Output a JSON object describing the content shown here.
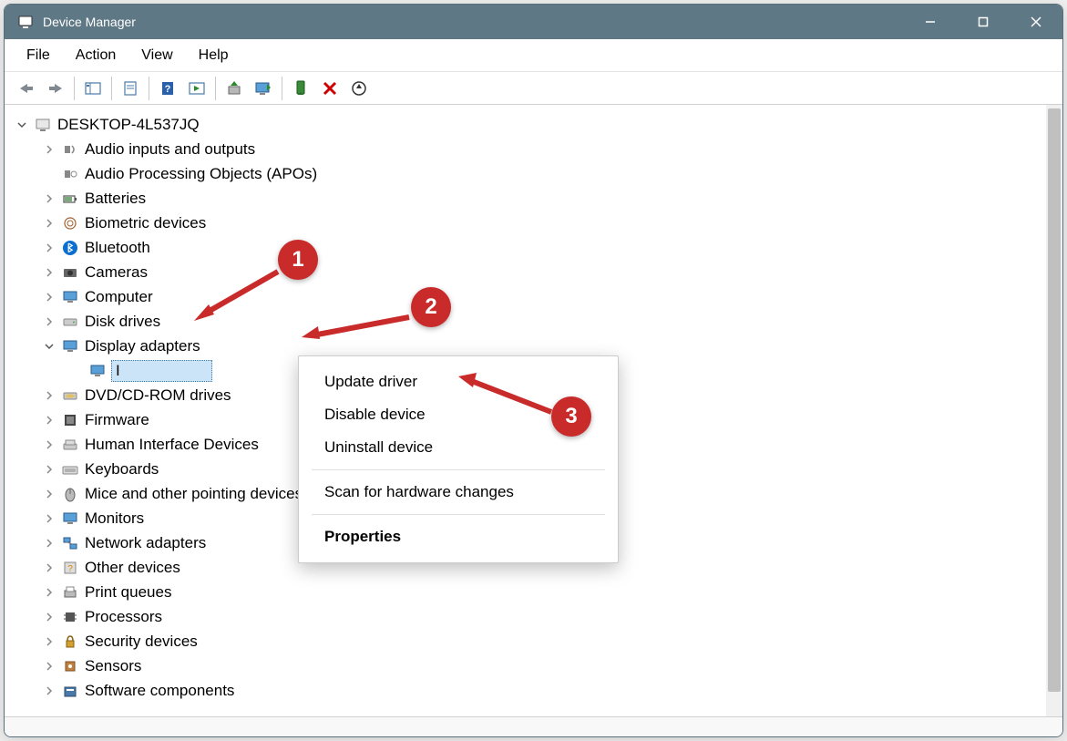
{
  "window": {
    "title": "Device Manager"
  },
  "menus": {
    "file": "File",
    "action": "Action",
    "view": "View",
    "help": "Help"
  },
  "root": {
    "name": "DESKTOP-4L537JQ"
  },
  "categories": [
    {
      "label": "Audio inputs and outputs",
      "expanded": false
    },
    {
      "label": "Audio Processing Objects (APOs)",
      "expanded": false,
      "no_chev": true
    },
    {
      "label": "Batteries",
      "expanded": false
    },
    {
      "label": "Biometric devices",
      "expanded": false
    },
    {
      "label": "Bluetooth",
      "expanded": false
    },
    {
      "label": "Cameras",
      "expanded": false
    },
    {
      "label": "Computer",
      "expanded": false
    },
    {
      "label": "Disk drives",
      "expanded": false
    },
    {
      "label": "Display adapters",
      "expanded": true,
      "child_selected": true
    },
    {
      "label": "DVD/CD-ROM drives",
      "expanded": false
    },
    {
      "label": "Firmware",
      "expanded": false
    },
    {
      "label": "Human Interface Devices",
      "expanded": false
    },
    {
      "label": "Keyboards",
      "expanded": false
    },
    {
      "label": "Mice and other pointing devices",
      "expanded": false
    },
    {
      "label": "Monitors",
      "expanded": false
    },
    {
      "label": "Network adapters",
      "expanded": false
    },
    {
      "label": "Other devices",
      "expanded": false
    },
    {
      "label": "Print queues",
      "expanded": false
    },
    {
      "label": "Processors",
      "expanded": false
    },
    {
      "label": "Security devices",
      "expanded": false
    },
    {
      "label": "Sensors",
      "expanded": false
    },
    {
      "label": "Software components",
      "expanded": false
    }
  ],
  "selected_device": {
    "label": "I"
  },
  "context_menu": {
    "update": "Update driver",
    "disable": "Disable device",
    "uninstall": "Uninstall device",
    "scan": "Scan for hardware changes",
    "properties": "Properties"
  },
  "annotations": {
    "step1": "1",
    "step2": "2",
    "step3": "3"
  }
}
